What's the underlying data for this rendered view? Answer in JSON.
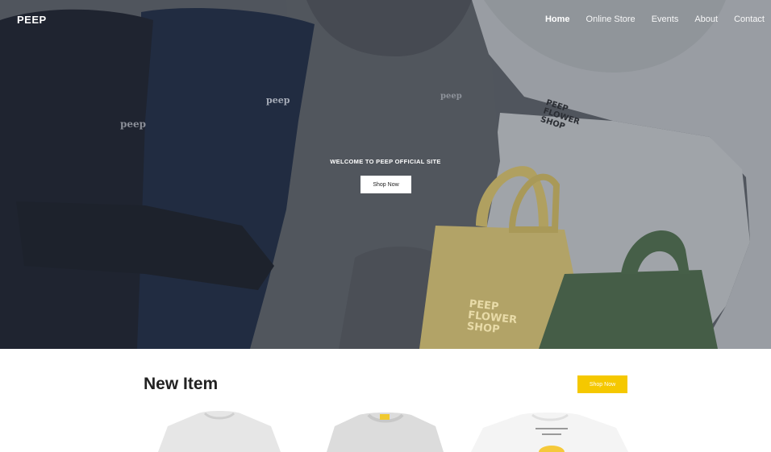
{
  "header": {
    "logo": "PEEP",
    "nav": [
      {
        "label": "Home",
        "active": true
      },
      {
        "label": "Online Store",
        "active": false
      },
      {
        "label": "Events",
        "active": false
      },
      {
        "label": "About",
        "active": false
      },
      {
        "label": "Contact",
        "active": false
      }
    ]
  },
  "hero": {
    "welcome": "WELCOME TO PEEP OFFICIAL SITE",
    "cta_label": "Shop Now",
    "print_text_1": "peep",
    "print_text_2": "peep",
    "print_text_3": "peep",
    "patch_text": "PEEP FLOWER SHOP",
    "tote_text": "PEEP FLOWER SHOP"
  },
  "new_item": {
    "title": "New Item",
    "shop_label": "Shop Now",
    "products": [
      {
        "name": "grey-tshirt"
      },
      {
        "name": "grey-sweatshirt"
      },
      {
        "name": "white-tshirt"
      }
    ]
  },
  "colors": {
    "accent": "#f5c800",
    "white": "#ffffff",
    "title": "#222222"
  }
}
